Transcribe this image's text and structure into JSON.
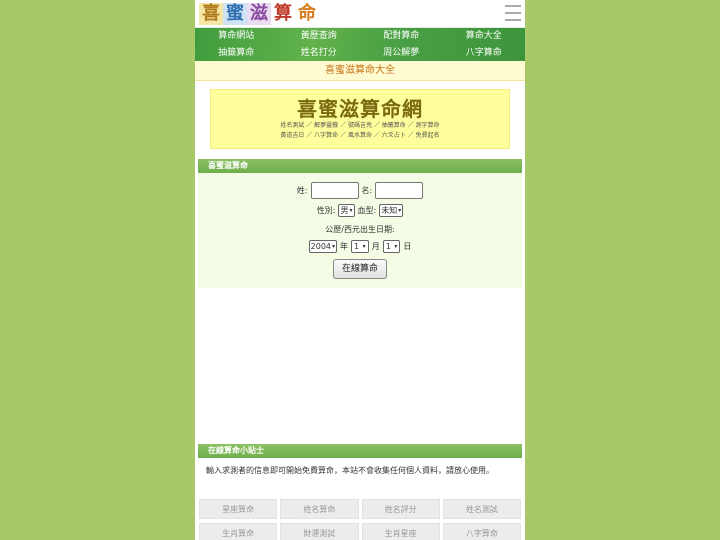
{
  "logo": [
    "喜",
    "蜜",
    "滋",
    "算",
    "命"
  ],
  "nav": [
    "算命網站",
    "黃歷查詢",
    "配對算命",
    "算命大全",
    "抽籤算命",
    "姓名打分",
    "周公解夢",
    "八字算命"
  ],
  "subtitle": "喜蜜滋算命大全",
  "banner": {
    "title": "喜蜜滋算命網",
    "line1": "姓名測試 ／ 解夢靈籤 ／ 號碼吉兇 ／ 抽籤算命 ／ 測字算命",
    "line2": "黃道吉日 ／ 八字算命 ／ 風水算命 ／ 六爻占卜 ／ 免費起名"
  },
  "form": {
    "heading": "喜蜜滋算命",
    "surname_label": "姓:",
    "name_label": "名:",
    "gender_label": "性別:",
    "gender_value": "男",
    "blood_label": "血型:",
    "blood_value": "未知",
    "date_label": "公歷/西元出生日期:",
    "year_value": "2004",
    "year_unit": "年",
    "month_value": "1",
    "month_unit": "月",
    "day_value": "1",
    "day_unit": "日",
    "submit": "在線算命"
  },
  "tips": {
    "heading": "在線算命小貼士",
    "text": "輸入求測者的信息即可開始免費算命，本站不會收集任何個人資料，請放心使用。"
  },
  "links": [
    "星座算命",
    "姓名算命",
    "姓名評分",
    "姓名測試",
    "生肖算命",
    "財運測試",
    "生肖星座",
    "八字算命"
  ],
  "colors": {
    "background": "#a9c86a",
    "nav": "#4aa044",
    "section_head": "#7bb654",
    "banner": "#fffe9c",
    "subtitle_text": "#c7741b"
  }
}
